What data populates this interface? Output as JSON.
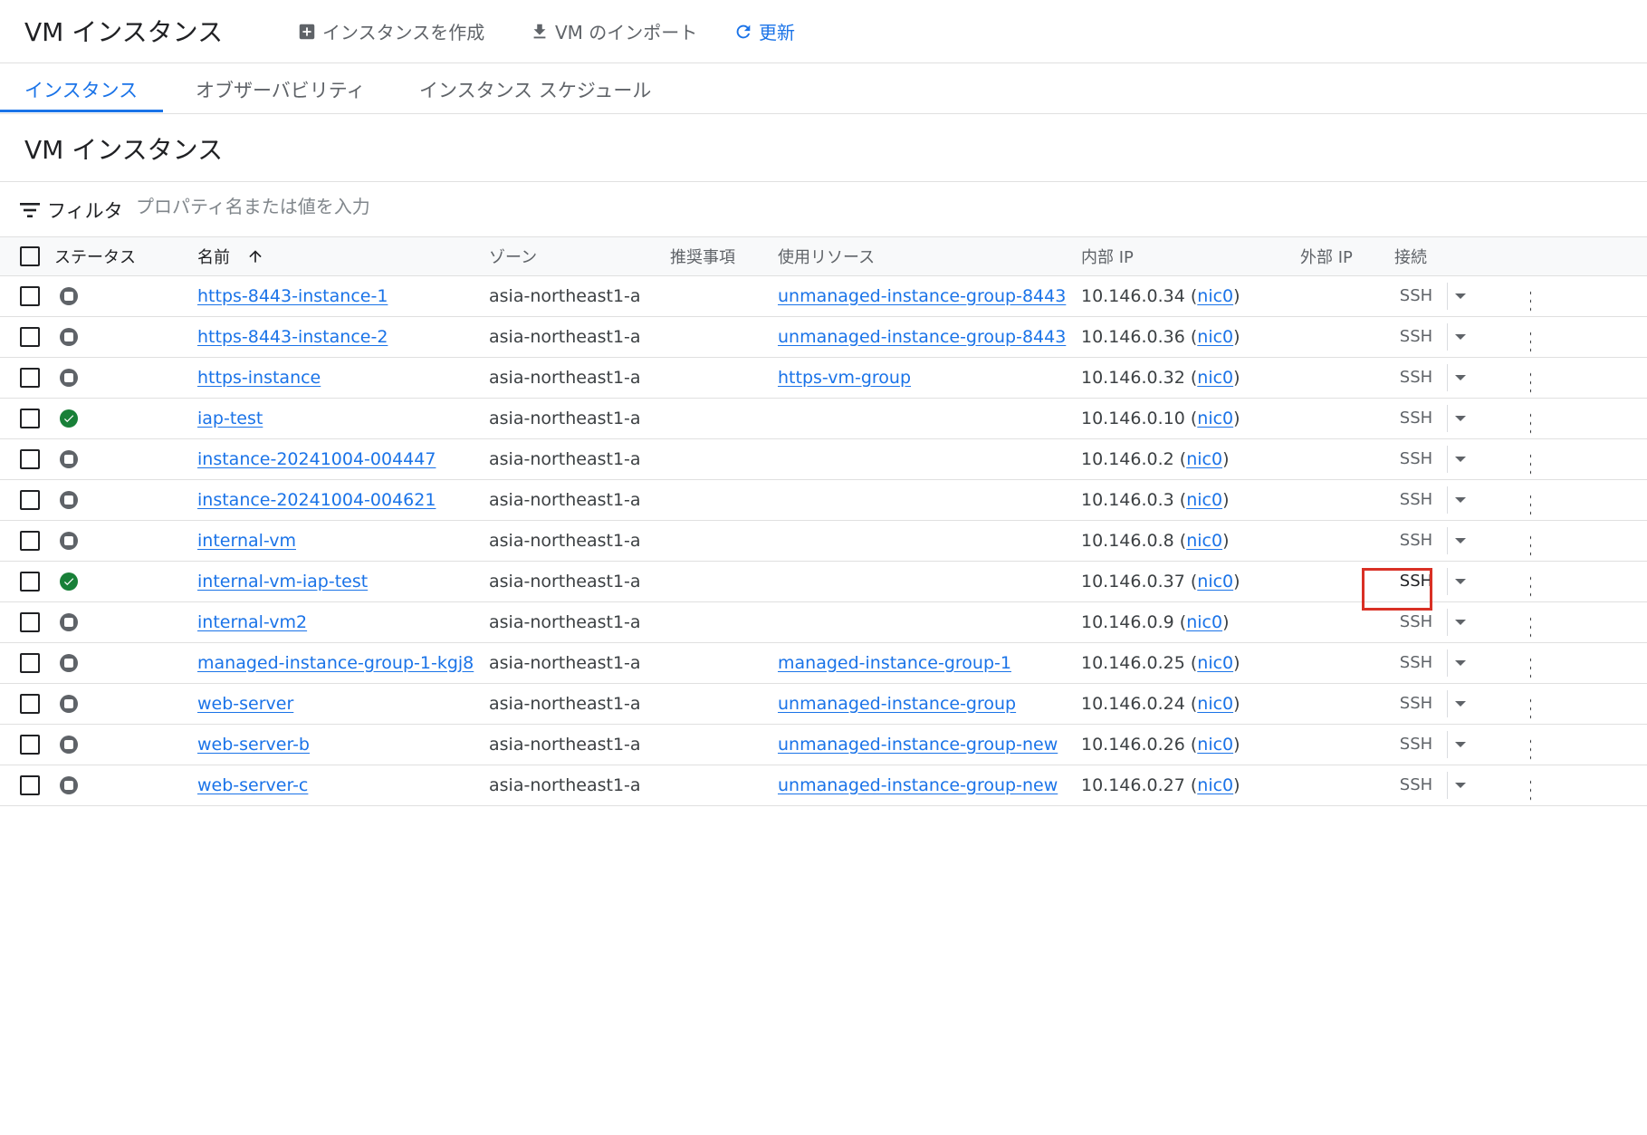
{
  "header": {
    "title": "VM インスタンス",
    "create_label": "インスタンスを作成",
    "import_label": "VM のインポート",
    "refresh_label": "更新"
  },
  "tabs": [
    {
      "label": "インスタンス",
      "active": true
    },
    {
      "label": "オブザーバビリティ",
      "active": false
    },
    {
      "label": "インスタンス スケジュール",
      "active": false
    }
  ],
  "section_title": "VM インスタンス",
  "filter": {
    "label": "フィルタ",
    "placeholder": "プロパティ名または値を入力"
  },
  "columns": {
    "status": "ステータス",
    "name": "名前",
    "zone": "ゾーン",
    "recommendation": "推奨事項",
    "in_use_by": "使用リソース",
    "internal_ip": "内部 IP",
    "external_ip": "外部 IP",
    "connect": "接続"
  },
  "ssh_label": "SSH",
  "nic_label": "nic0",
  "instances": [
    {
      "status": "stopped",
      "name": "https-8443-instance-1",
      "zone": "asia-northeast1-a",
      "in_use_by": "unmanaged-instance-group-8443",
      "ip": "10.146.0.34"
    },
    {
      "status": "stopped",
      "name": "https-8443-instance-2",
      "zone": "asia-northeast1-a",
      "in_use_by": "unmanaged-instance-group-8443",
      "ip": "10.146.0.36"
    },
    {
      "status": "stopped",
      "name": "https-instance",
      "zone": "asia-northeast1-a",
      "in_use_by": "https-vm-group",
      "ip": "10.146.0.32"
    },
    {
      "status": "running",
      "name": "iap-test",
      "zone": "asia-northeast1-a",
      "in_use_by": "",
      "ip": "10.146.0.10"
    },
    {
      "status": "stopped",
      "name": "instance-20241004-004447",
      "zone": "asia-northeast1-a",
      "in_use_by": "",
      "ip": "10.146.0.2"
    },
    {
      "status": "stopped",
      "name": "instance-20241004-004621",
      "zone": "asia-northeast1-a",
      "in_use_by": "",
      "ip": "10.146.0.3"
    },
    {
      "status": "stopped",
      "name": "internal-vm",
      "zone": "asia-northeast1-a",
      "in_use_by": "",
      "ip": "10.146.0.8"
    },
    {
      "status": "running",
      "name": "internal-vm-iap-test",
      "zone": "asia-northeast1-a",
      "in_use_by": "",
      "ip": "10.146.0.37",
      "ssh_highlighted": true
    },
    {
      "status": "stopped",
      "name": "internal-vm2",
      "zone": "asia-northeast1-a",
      "in_use_by": "",
      "ip": "10.146.0.9"
    },
    {
      "status": "stopped",
      "name": "managed-instance-group-1-kgj8",
      "zone": "asia-northeast1-a",
      "in_use_by": "managed-instance-group-1",
      "ip": "10.146.0.25"
    },
    {
      "status": "stopped",
      "name": "web-server",
      "zone": "asia-northeast1-a",
      "in_use_by": "unmanaged-instance-group",
      "ip": "10.146.0.24"
    },
    {
      "status": "stopped",
      "name": "web-server-b",
      "zone": "asia-northeast1-a",
      "in_use_by": "unmanaged-instance-group-new",
      "ip": "10.146.0.26"
    },
    {
      "status": "stopped",
      "name": "web-server-c",
      "zone": "asia-northeast1-a",
      "in_use_by": "unmanaged-instance-group-new",
      "ip": "10.146.0.27"
    }
  ],
  "colors": {
    "accent": "#1a73e8",
    "running": "#188038",
    "stopped": "#5f6368",
    "highlight": "#d93025"
  }
}
